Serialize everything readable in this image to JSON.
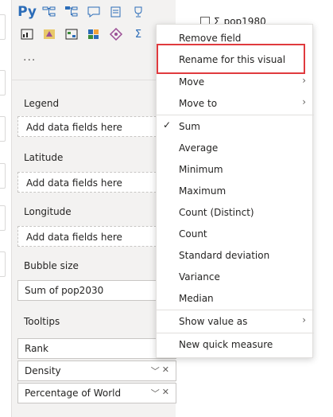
{
  "viz_pane": {
    "icons_row1": [
      "py-icon",
      "decomposition-tree-icon",
      "key-influencers-icon",
      "qa-icon",
      "smart-narrative-icon",
      "trophy-icon"
    ],
    "icons_row2": [
      "paginated-report-icon",
      "power-apps-icon",
      "power-automate-icon",
      "arcgis-icon",
      "diamond-icon",
      "sigma-icon"
    ],
    "py_label": "Py",
    "more_label": "...",
    "wells": {
      "legend": {
        "title": "Legend",
        "placeholder": "Add data fields here"
      },
      "latitude": {
        "title": "Latitude",
        "placeholder": "Add data fields here"
      },
      "longitude": {
        "title": "Longitude",
        "placeholder": "Add data fields here"
      },
      "bubble_size": {
        "title": "Bubble size",
        "field": "Sum of pop2030"
      },
      "tooltips": {
        "title": "Tooltips",
        "fields": [
          "Rank",
          "Density",
          "Percentage of World"
        ]
      }
    }
  },
  "fields_pane": {
    "visible_field": {
      "sigma": "Σ",
      "name": "pop1980"
    }
  },
  "context_menu": {
    "items": [
      {
        "label": "Remove field",
        "checked": false,
        "submenu": false
      },
      {
        "label": "Rename for this visual",
        "checked": false,
        "submenu": false,
        "highlighted": true
      },
      {
        "label": "Move",
        "checked": false,
        "submenu": true
      },
      {
        "label": "Move to",
        "checked": false,
        "submenu": true
      },
      {
        "label": "Sum",
        "checked": true,
        "submenu": false
      },
      {
        "label": "Average",
        "checked": false,
        "submenu": false
      },
      {
        "label": "Minimum",
        "checked": false,
        "submenu": false
      },
      {
        "label": "Maximum",
        "checked": false,
        "submenu": false
      },
      {
        "label": "Count (Distinct)",
        "checked": false,
        "submenu": false
      },
      {
        "label": "Count",
        "checked": false,
        "submenu": false
      },
      {
        "label": "Standard deviation",
        "checked": false,
        "submenu": false
      },
      {
        "label": "Variance",
        "checked": false,
        "submenu": false
      },
      {
        "label": "Median",
        "checked": false,
        "submenu": false
      },
      {
        "label": "Show value as",
        "checked": false,
        "submenu": true
      },
      {
        "label": "New quick measure",
        "checked": false,
        "submenu": false
      }
    ],
    "check_glyph": "✓",
    "submenu_glyph": "›"
  },
  "colors": {
    "highlight_border": "#e03a3e",
    "pane_bg": "#f3f2f1",
    "py_blue": "#2b6cb8"
  }
}
